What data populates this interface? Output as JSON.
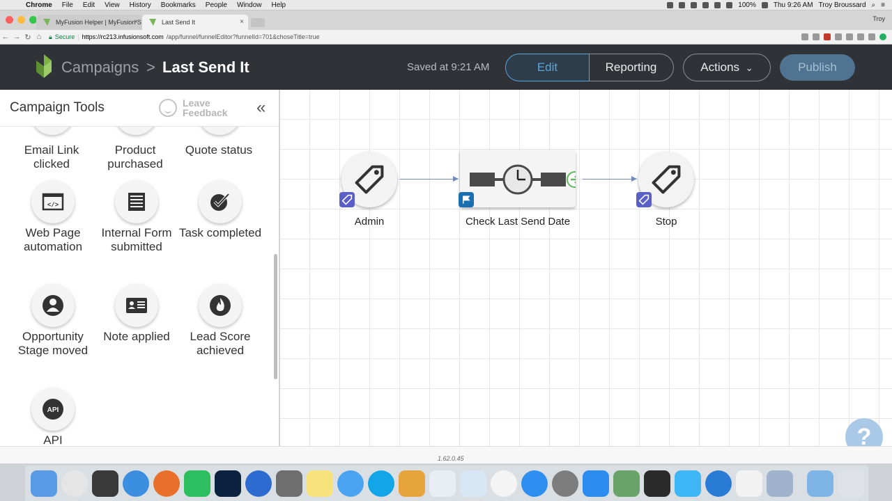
{
  "menubar": {
    "app": "Chrome",
    "items": [
      "File",
      "Edit",
      "View",
      "History",
      "Bookmarks",
      "People",
      "Window",
      "Help"
    ],
    "battery": "100%",
    "clock": "Thu 9:26 AM",
    "user": "Troy Broussard"
  },
  "browser": {
    "tabs": [
      {
        "title": "MyFusion Helper | MyFusion S"
      },
      {
        "title": "Last Send It"
      }
    ],
    "profile": "Troy",
    "secure_label": "Secure",
    "url_host": "https://rc213.infusionsoft.com",
    "url_path": "/app/funnel/funnelEditor?funnelId=701&choseTitle=true"
  },
  "header": {
    "breadcrumb_root": "Campaigns",
    "separator": ">",
    "campaign_name": "Last Send It",
    "saved_status": "Saved at 9:21 AM",
    "edit_label": "Edit",
    "reporting_label": "Reporting",
    "actions_label": "Actions",
    "publish_label": "Publish"
  },
  "sidebar": {
    "title": "Campaign Tools",
    "feedback_line1": "Leave",
    "feedback_line2": "Feedback",
    "collapse_icon": "«",
    "tools": [
      {
        "label": "Email Link clicked",
        "icon": "link-icon"
      },
      {
        "label": "Product purchased",
        "icon": "cart-icon"
      },
      {
        "label": "Quote status",
        "icon": "quote-icon"
      },
      {
        "label": "Web Page automation",
        "icon": "code-icon",
        "glyph": "</>"
      },
      {
        "label": "Internal Form submitted",
        "icon": "form-icon"
      },
      {
        "label": "Task completed",
        "icon": "check-icon"
      },
      {
        "label": "Opportunity Stage moved",
        "icon": "person-icon"
      },
      {
        "label": "Note applied",
        "icon": "card-icon"
      },
      {
        "label": "Lead Score achieved",
        "icon": "flame-icon"
      },
      {
        "label": "API",
        "icon": "api-icon",
        "glyph": "API"
      }
    ]
  },
  "canvas": {
    "nodes": [
      {
        "label": "Admin",
        "type": "tag-sequence"
      },
      {
        "label": "Check Last Send Date",
        "type": "timer"
      },
      {
        "label": "Stop",
        "type": "tag-sequence"
      }
    ],
    "help_glyph": "?"
  },
  "footer": {
    "version": "1.62.0.45"
  },
  "colors": {
    "header_bg": "#2f3237",
    "accent_blue": "#58a8de",
    "publish_bg": "#4f7390",
    "badge_purple": "#5a5fc8",
    "badge_blue": "#1a6fb0"
  }
}
